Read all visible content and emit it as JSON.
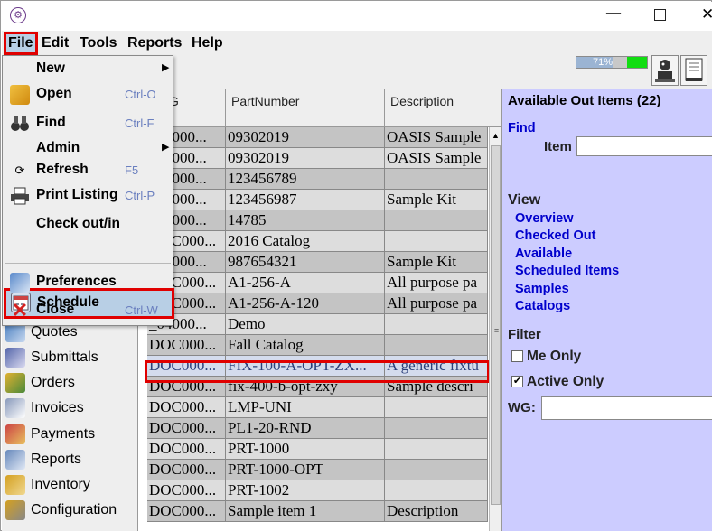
{
  "titlebar": {
    "minimize_glyph": "—",
    "close_glyph": "✕"
  },
  "menubar": {
    "file": "File",
    "edit": "Edit",
    "tools": "Tools",
    "reports": "Reports",
    "help": "Help"
  },
  "toolbar": {
    "progress_text": "71%",
    "progress_value": 71
  },
  "file_menu": {
    "items": [
      {
        "label": "New",
        "shortcut": "",
        "submenu": true
      },
      {
        "label": "Open",
        "shortcut": "Ctrl-O"
      },
      {
        "label": "Find",
        "shortcut": "Ctrl-F"
      },
      {
        "label": "Admin",
        "shortcut": "",
        "submenu": true
      },
      {
        "label": "Refresh",
        "shortcut": "F5"
      },
      {
        "label": "Print Listing",
        "shortcut": "Ctrl-P"
      },
      {
        "label": "Check out/in",
        "shortcut": ""
      },
      {
        "label": "Schedule",
        "shortcut": ""
      },
      {
        "label": "Preferences",
        "shortcut": ""
      },
      {
        "label": "Close",
        "shortcut": "Ctrl-W"
      }
    ]
  },
  "nav": {
    "items": [
      {
        "label": "Quotes",
        "icon": "quotes-icon"
      },
      {
        "label": "Submittals",
        "icon": "submittals-icon"
      },
      {
        "label": "Orders",
        "icon": "orders-icon"
      },
      {
        "label": "Invoices",
        "icon": "invoices-icon"
      },
      {
        "label": "Payments",
        "icon": "payments-icon"
      },
      {
        "label": "Reports",
        "icon": "reports-icon"
      },
      {
        "label": "Inventory",
        "icon": "inventory-icon"
      },
      {
        "label": "Configuration",
        "icon": "configuration-icon"
      }
    ]
  },
  "grid": {
    "headers": [
      "G",
      "PartNumber",
      "Description"
    ],
    "rows": [
      {
        "c1": "_04000...",
        "c2": "09302019",
        "c3": "OASIS Sample"
      },
      {
        "c1": "_04000...",
        "c2": "09302019",
        "c3": "OASIS Sample"
      },
      {
        "c1": "_04000...",
        "c2": "123456789",
        "c3": ""
      },
      {
        "c1": "_04000...",
        "c2": "123456987",
        "c3": "Sample Kit"
      },
      {
        "c1": "_03000...",
        "c2": "14785",
        "c3": ""
      },
      {
        "c1": "DOC000...",
        "c2": "2016 Catalog",
        "c3": ""
      },
      {
        "c1": "_04000...",
        "c2": "987654321",
        "c3": "Sample Kit"
      },
      {
        "c1": "DOC000...",
        "c2": "A1-256-A",
        "c3": "All purpose pa"
      },
      {
        "c1": "DOC000...",
        "c2": "A1-256-A-120",
        "c3": "All purpose pa"
      },
      {
        "c1": "_04000...",
        "c2": "Demo",
        "c3": ""
      },
      {
        "c1": "DOC000...",
        "c2": "Fall Catalog",
        "c3": ""
      },
      {
        "c1": "DOC000...",
        "c2": "FIX-100-A-OPT-ZX...",
        "c3": "A generic fixtu"
      },
      {
        "c1": "DOC000...",
        "c2": "fix-400-b-opt-zxy",
        "c3": "Sample descri"
      },
      {
        "c1": "DOC000...",
        "c2": "LMP-UNI",
        "c3": ""
      },
      {
        "c1": "DOC000...",
        "c2": "PL1-20-RND",
        "c3": ""
      },
      {
        "c1": "DOC000...",
        "c2": "PRT-1000",
        "c3": ""
      },
      {
        "c1": "DOC000...",
        "c2": "PRT-1000-OPT",
        "c3": ""
      },
      {
        "c1": "DOC000...",
        "c2": "PRT-1002",
        "c3": ""
      },
      {
        "c1": "DOC000...",
        "c2": "Sample item 1",
        "c3": "Description"
      }
    ]
  },
  "right_panel": {
    "title": "Available Out Items (22)",
    "find_label": "Find",
    "item_label": "Item",
    "item_value": "",
    "view_label": "View",
    "view_links": [
      "Overview",
      "Checked Out",
      "Available",
      "Scheduled Items",
      "Samples",
      "Catalogs"
    ],
    "filter_label": "Filter",
    "me_only": "Me Only",
    "me_only_checked": false,
    "active_only": "Active Only",
    "active_only_checked": true,
    "wg_label": "WG:",
    "wg_value": "",
    "check_glyph": "✔"
  },
  "colors": {
    "highlight_red": "#e00000",
    "selection_blue": "#b8cfe5",
    "panel_lavender": "#ccccff",
    "link_blue": "#0000cc",
    "progress_green": "#11dd11"
  }
}
